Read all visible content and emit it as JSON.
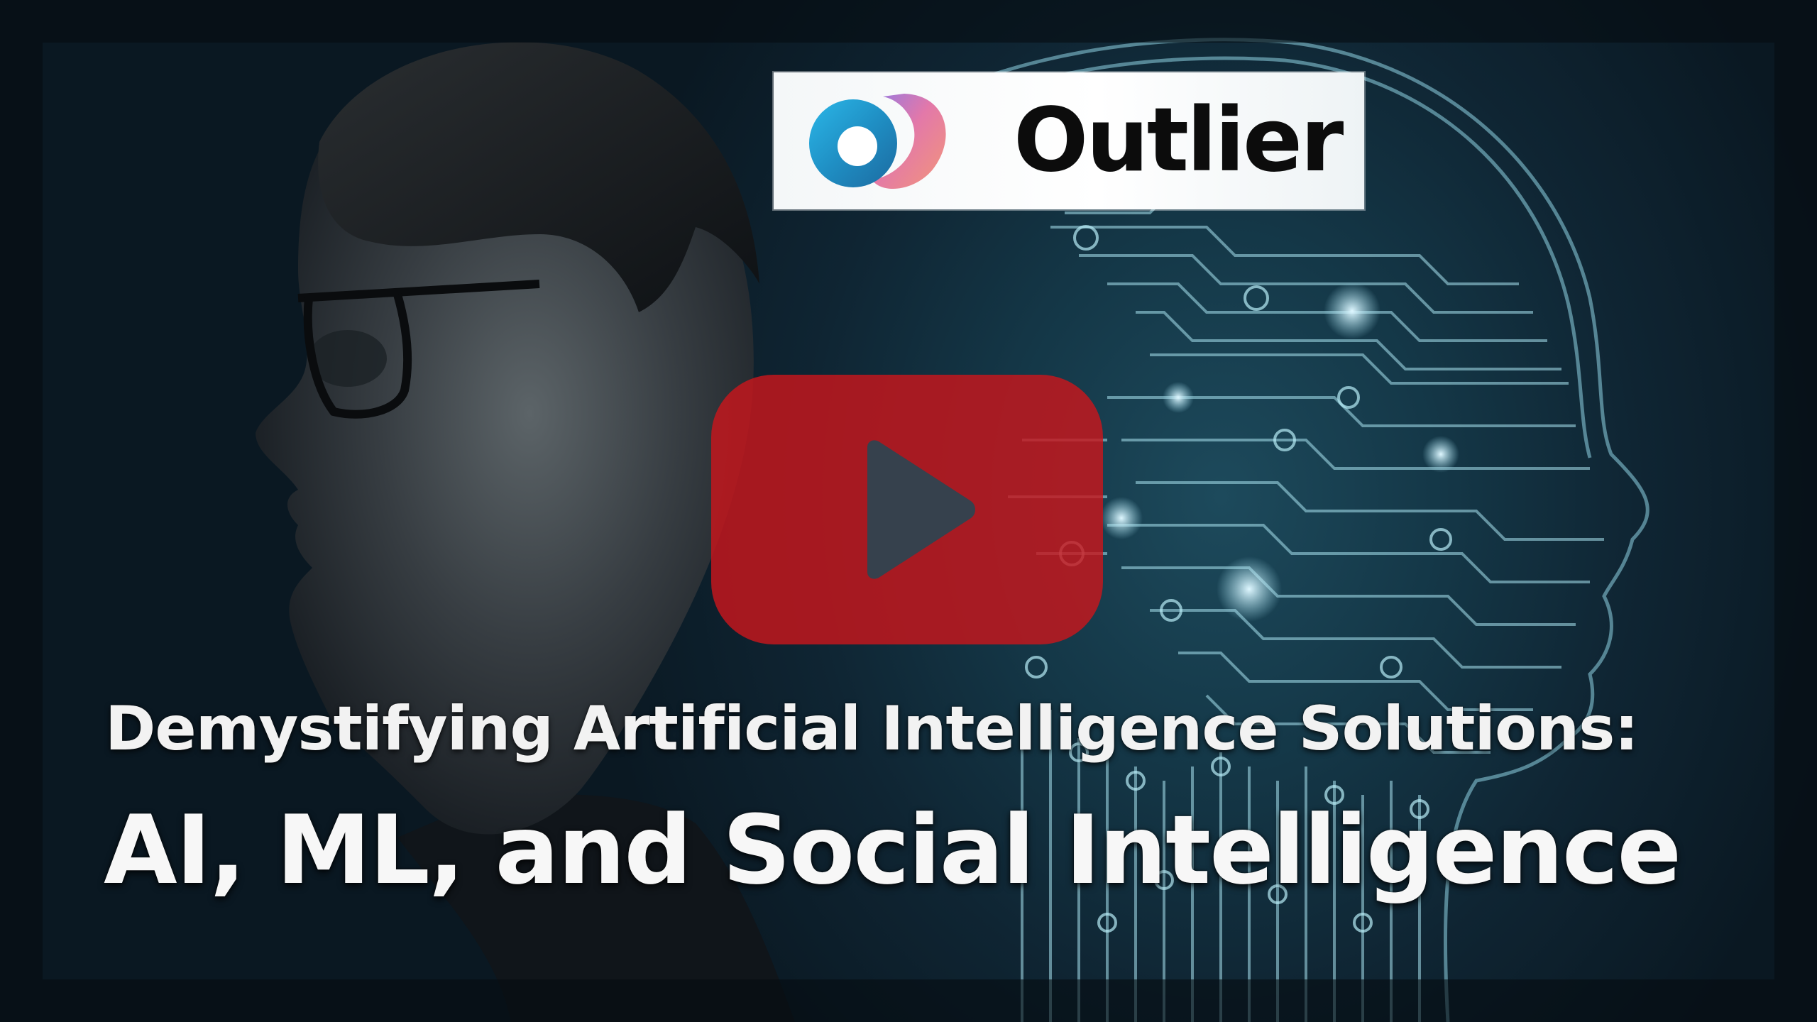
{
  "video": {
    "brand_name": "Outlier",
    "title_line_1": "Demystifying Artificial Intelligence Solutions:",
    "title_line_2": "AI, ML, and Social Intelligence"
  },
  "colors": {
    "play_button": "#c8161c",
    "background": "#0f2533",
    "circuit_glow": "#a9e3f0",
    "title_text": "#f2f2f2"
  },
  "icons": {
    "play": "play-icon",
    "logo": "outlier-logo-icon"
  }
}
